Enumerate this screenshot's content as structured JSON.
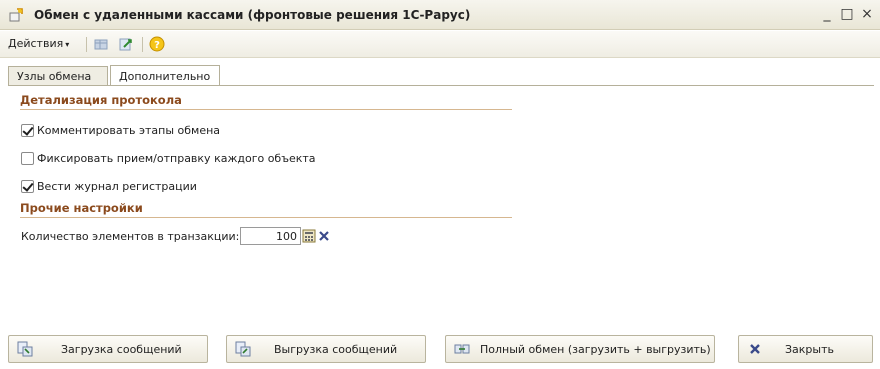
{
  "window": {
    "title": "Обмен с удаленными кассами (фронтовые решения 1С-Рарус)",
    "minimize": "_",
    "maximize": "□",
    "close": "×"
  },
  "toolbar": {
    "actions_label": "Действия",
    "actions_arrow": "▾"
  },
  "tabs": [
    {
      "label": "Узлы обмена",
      "active": false
    },
    {
      "label": "Дополнительно",
      "active": true
    }
  ],
  "sections": {
    "protocol": {
      "title": "Детализация протокола",
      "checks": [
        {
          "label": "Комментировать этапы обмена",
          "checked": true
        },
        {
          "label": "Фиксировать прием/отправку каждого объекта",
          "checked": false
        },
        {
          "label": "Вести журнал регистрации",
          "checked": true
        }
      ]
    },
    "other": {
      "title": "Прочие настройки",
      "transaction_label": "Количество элементов в транзакции:",
      "transaction_value": "100"
    }
  },
  "buttons": {
    "load": "Загрузка сообщений",
    "unload": "Выгрузка сообщений",
    "full": "Полный обмен (загрузить + выгрузить)",
    "close": "Закрыть"
  },
  "colors": {
    "section_title": "#8b4a1d",
    "accent": "#e6b800"
  }
}
